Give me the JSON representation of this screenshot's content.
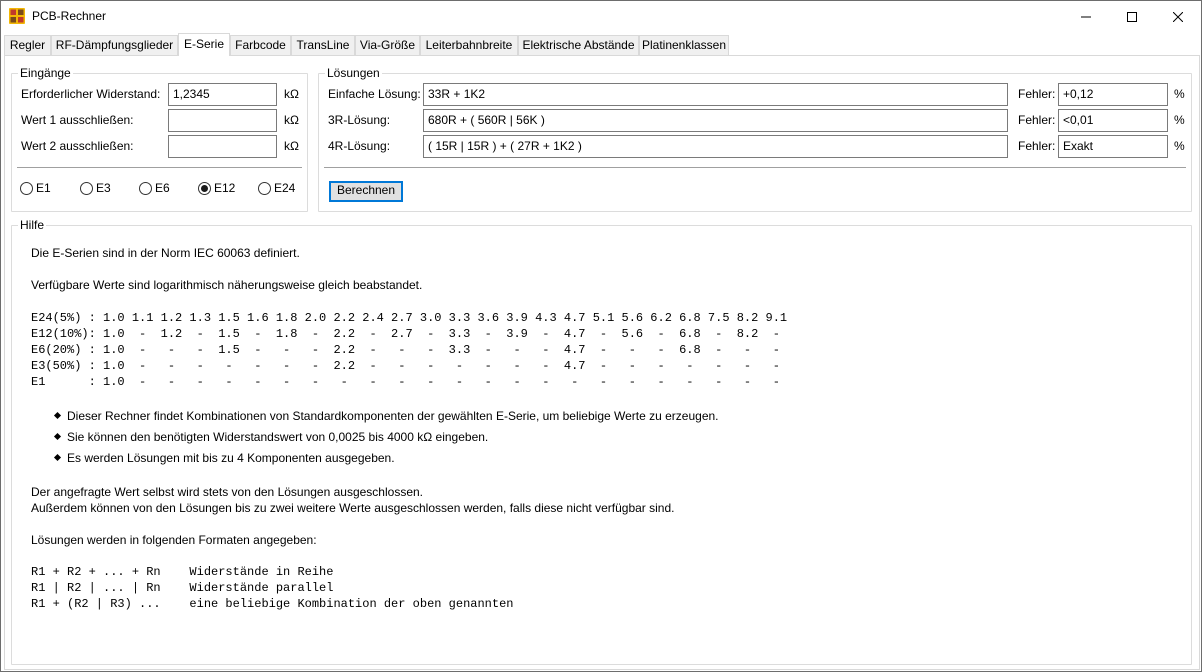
{
  "window": {
    "title": "PCB-Rechner"
  },
  "tabs": [
    "Regler",
    "RF-Dämpfungsglieder",
    "E-Serie",
    "Farbcode",
    "TransLine",
    "Via-Größe",
    "Leiterbahnbreite",
    "Elektrische Abstände",
    "Platinenklassen"
  ],
  "active_tab": "E-Serie",
  "inputs": {
    "group_label": "Eingänge",
    "rows": [
      {
        "label": "Erforderlicher Widerstand:",
        "value": "1,2345",
        "unit": "kΩ"
      },
      {
        "label": "Wert 1 ausschließen:",
        "value": "",
        "unit": "kΩ"
      },
      {
        "label": "Wert 2 ausschließen:",
        "value": "",
        "unit": "kΩ"
      }
    ],
    "series_options": [
      "E1",
      "E3",
      "E6",
      "E12",
      "E24"
    ],
    "selected_series": "E12"
  },
  "solutions": {
    "group_label": "Lösungen",
    "rows": [
      {
        "label": "Einfache Lösung:",
        "value": "33R + 1K2",
        "error_label": "Fehler:",
        "error": "+0,12",
        "unit": "%"
      },
      {
        "label": "3R-Lösung:",
        "value": "680R + ( 560R | 56K )",
        "error_label": "Fehler:",
        "error": "<0,01",
        "unit": "%"
      },
      {
        "label": "4R-Lösung:",
        "value": "( 15R | 15R ) + ( 27R + 1K2 )",
        "error_label": "Fehler:",
        "error": "Exakt",
        "unit": "%"
      }
    ],
    "calculate_label": "Berechnen"
  },
  "help": {
    "group_label": "Hilfe",
    "p1": "Die E-Serien sind in der Norm IEC 60063 definiert.",
    "p2": "Verfügbare Werte sind logarithmisch näherungsweise gleich beabstandet.",
    "table": [
      "E24(5%) : 1.0 1.1 1.2 1.3 1.5 1.6 1.8 2.0 2.2 2.4 2.7 3.0 3.3 3.6 3.9 4.3 4.7 5.1 5.6 6.2 6.8 7.5 8.2 9.1",
      "E12(10%): 1.0  -  1.2  -  1.5  -  1.8  -  2.2  -  2.7  -  3.3  -  3.9  -  4.7  -  5.6  -  6.8  -  8.2  -",
      "E6(20%) : 1.0  -   -   -  1.5  -   -   -  2.2  -   -   -  3.3  -   -   -  4.7  -   -   -  6.8  -   -   -",
      "E3(50%) : 1.0  -   -   -   -   -   -   -  2.2  -   -   -   -   -   -   -  4.7  -   -   -   -   -   -   -",
      "E1      : 1.0  -   -   -   -   -   -   -   -   -   -   -   -   -   -   -   -   -   -   -   -   -   -   -"
    ],
    "bullets": [
      "Dieser Rechner findet Kombinationen von Standardkomponenten der gewählten E-Serie, um beliebige Werte zu erzeugen.",
      "Sie können den benötigten Widerstandswert von 0,0025 bis 4000 kΩ eingeben.",
      "Es werden Lösungen mit bis zu 4 Komponenten ausgegeben."
    ],
    "p3a": "Der angefragte Wert selbst wird stets von den Lösungen ausgeschlossen.",
    "p3b": "Außerdem können von den Lösungen bis zu zwei weitere Werte ausgeschlossen werden, falls diese nicht verfügbar sind.",
    "p4": "Lösungen werden in folgenden Formaten angegeben:",
    "formats": [
      "R1 + R2 + ... + Rn    Widerstände in Reihe",
      "R1 | R2 | ... | Rn    Widerstände parallel",
      "R1 + (R2 | R3) ...    eine beliebige Kombination der oben genannten"
    ]
  }
}
